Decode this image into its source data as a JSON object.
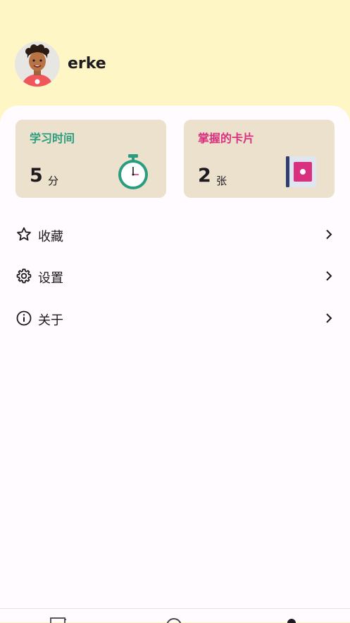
{
  "profile": {
    "username": "erke"
  },
  "stats": {
    "study_time": {
      "title": "学习时间",
      "value": "5",
      "unit": "分"
    },
    "mastered_cards": {
      "title": "掌握的卡片",
      "value": "2",
      "unit": "张"
    }
  },
  "menu": {
    "items": [
      {
        "label": "收藏",
        "icon": "star-icon"
      },
      {
        "label": "设置",
        "icon": "gear-icon"
      },
      {
        "label": "关于",
        "icon": "info-icon"
      }
    ]
  },
  "bottom_nav": {
    "items": [
      {
        "icon": "cards-icon"
      },
      {
        "icon": "circle-icon"
      },
      {
        "icon": "person-icon"
      }
    ]
  },
  "colors": {
    "header_bg": "#fff6c6",
    "card_bg": "#ebe1cd",
    "study_accent": "#2a9d7e",
    "cards_accent": "#d9317f"
  }
}
